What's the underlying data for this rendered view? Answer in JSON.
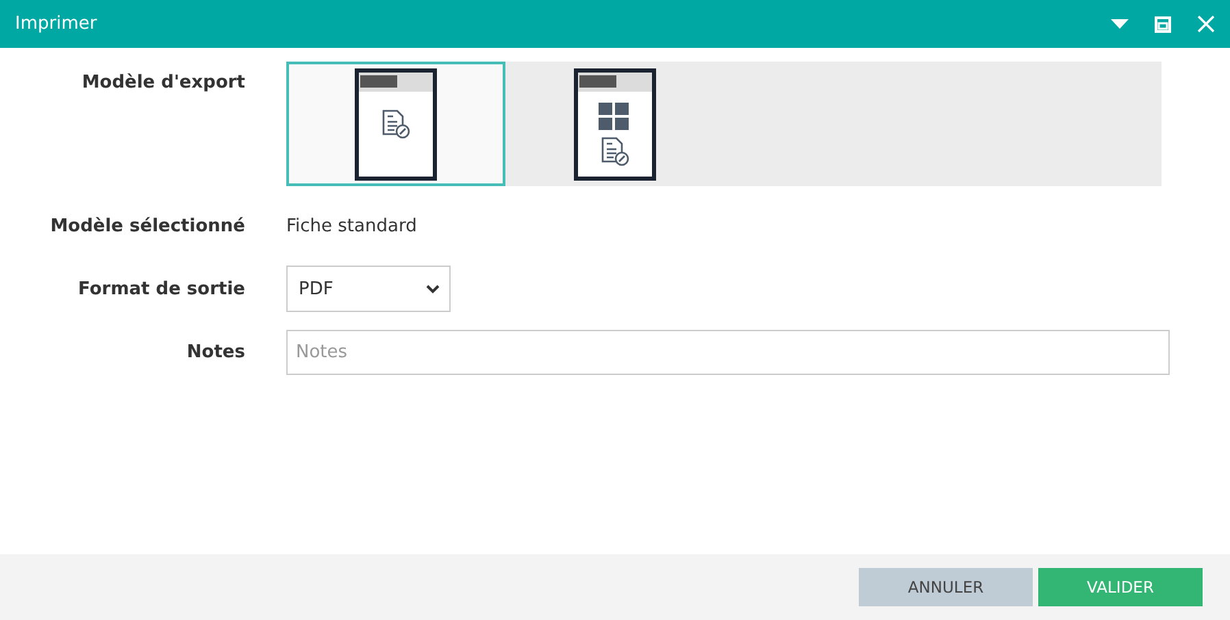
{
  "window": {
    "title": "Imprimer"
  },
  "export_model": {
    "label": "Modèle d'export",
    "templates": [
      {
        "kind": "single",
        "selected": true
      },
      {
        "kind": "grid",
        "selected": false
      }
    ]
  },
  "selected_model": {
    "label": "Modèle sélectionné",
    "value": "Fiche standard"
  },
  "output_format": {
    "label": "Format de sortie",
    "value": "PDF"
  },
  "notes": {
    "label": "Notes",
    "placeholder": "Notes"
  },
  "buttons": [
    {
      "label": "ANNULER",
      "kind": "cancel"
    },
    {
      "label": "VALIDER",
      "kind": "primary"
    }
  ]
}
